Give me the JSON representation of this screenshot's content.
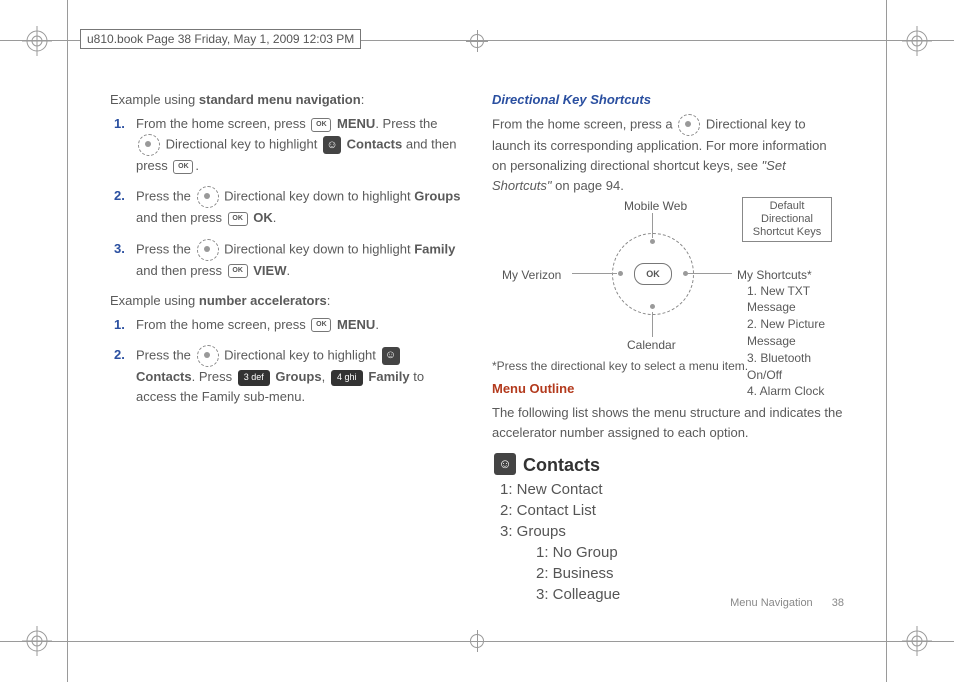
{
  "header_note": "u810.book  Page 38  Friday, May 1, 2009  12:03 PM",
  "left": {
    "ex1_intro_a": "Example using ",
    "ex1_intro_b": "standard menu navigation",
    "ex1_intro_c": ":",
    "s1a": "From the home screen, press ",
    "s1b": "MENU",
    "s1c": ". Press the ",
    "s1d": "Directional key to highlight ",
    "s1e": "Contacts",
    "s1f": " and then press ",
    "s1g": ".",
    "s2a": "Press the ",
    "s2b": " Directional key down to highlight ",
    "s2c": "Groups",
    "s2d": " and then press ",
    "s2e": "OK",
    "s2f": ".",
    "s3a": "Press the ",
    "s3b": " Directional key down to highlight ",
    "s3c": "Family",
    "s3d": " and then press ",
    "s3e": "VIEW",
    "s3f": ".",
    "ex2_intro_a": "Example using ",
    "ex2_intro_b": "number accelerators",
    "ex2_intro_c": ":",
    "t1a": "From the home screen, press ",
    "t1b": "MENU",
    "t1c": ".",
    "t2a": "Press the ",
    "t2b": " Directional key to highlight ",
    "t2c": "Contacts",
    "t2d": ". Press ",
    "t2e": "Groups",
    "t2f": ", ",
    "t2g": "Family",
    "t2h": " to access the Family sub-menu.",
    "key3": "3 def",
    "key4": "4 ghi"
  },
  "right": {
    "h1": "Directional Key Shortcuts",
    "p1a": "From the home screen, press a ",
    "p1b": " Directional key to launch its corresponding application. For more information on personalizing directional shortcut keys, see ",
    "p1c": "\"Set Shortcuts\"",
    "p1d": " on page 94.",
    "diagram": {
      "top": "Mobile Web",
      "left": "My Verizon",
      "right": "My Shortcuts*",
      "bottom": "Calendar",
      "ok": "OK",
      "box1": "Default Directional",
      "box2": "Shortcut Keys",
      "list1": "1. New TXT Message",
      "list2": "2. New Picture Message",
      "list3": "3. Bluetooth On/Off",
      "list4": "4. Alarm Clock"
    },
    "note": "*Press the directional key to select a menu item.",
    "h2": "Menu Outline",
    "p2": "The following list shows the menu structure and indicates the accelerator number assigned to each option.",
    "contacts_title": "Contacts",
    "c1": "1: New Contact",
    "c2": "2: Contact List",
    "c3": "3: Groups",
    "c3a": "1: No Group",
    "c3b": "2: Business",
    "c3c": "3: Colleague"
  },
  "footer": {
    "section": "Menu Navigation",
    "page": "38"
  }
}
